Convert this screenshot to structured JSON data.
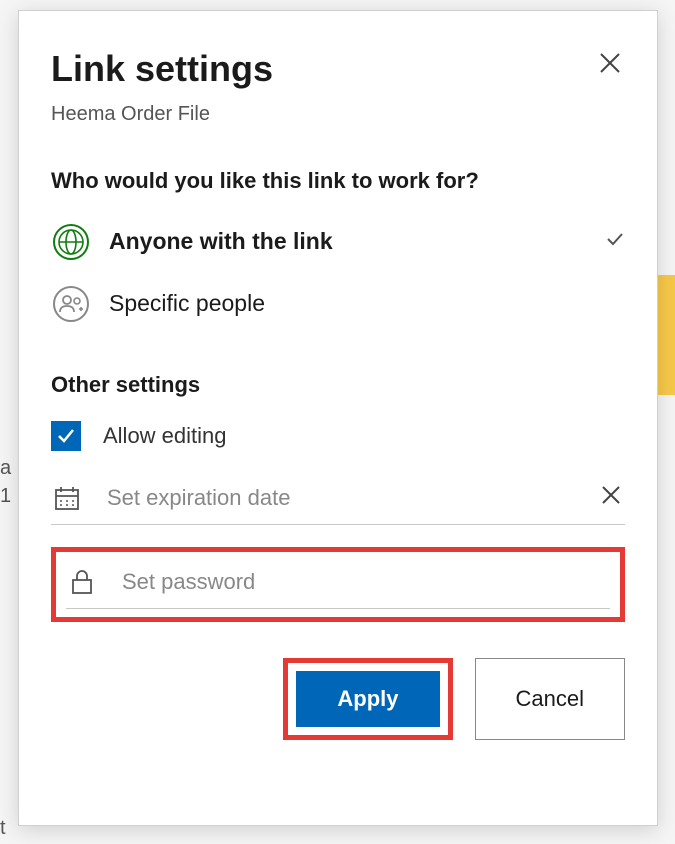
{
  "dialog": {
    "title": "Link settings",
    "subtitle": "Heema Order File",
    "question": "Who would you like this link to work for?",
    "options": [
      {
        "label": "Anyone with the link",
        "selected": true
      },
      {
        "label": "Specific people",
        "selected": false
      }
    ],
    "other_settings_header": "Other settings",
    "allow_editing": {
      "label": "Allow editing",
      "checked": true
    },
    "expiration": {
      "placeholder": "Set expiration date",
      "value": ""
    },
    "password": {
      "placeholder": "Set password",
      "value": ""
    },
    "buttons": {
      "apply": "Apply",
      "cancel": "Cancel"
    }
  }
}
